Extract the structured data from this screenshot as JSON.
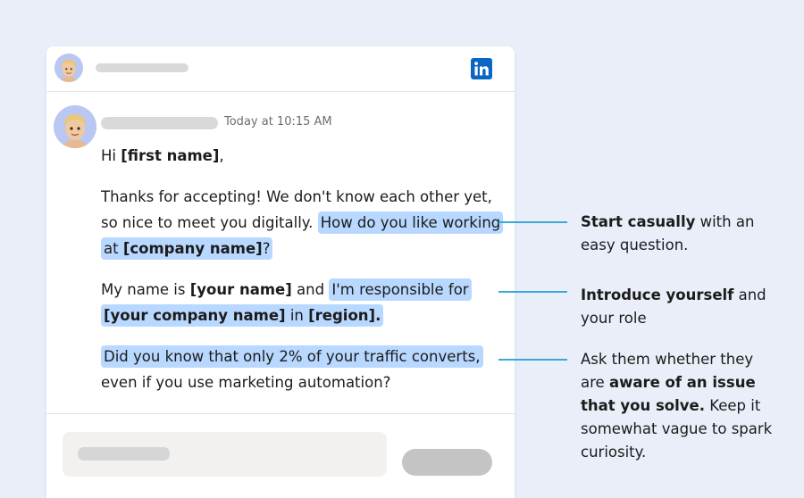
{
  "colors": {
    "background": "#e9eef8",
    "highlight": "#b9d8ff",
    "connector": "#3aa9d8",
    "linkedin": "#0a66c2",
    "avatar_bg": "#b9c7f2"
  },
  "header": {
    "brand_icon": "linkedin-icon",
    "avatar_icon": "memoji-avatar-icon"
  },
  "message": {
    "avatar_icon": "memoji-avatar-icon",
    "time": "Today at 10:15 AM",
    "greeting": {
      "prefix": "Hi ",
      "first_name": "[first name]",
      "suffix": ","
    },
    "para1": {
      "text": "Thanks for accepting! We don't know each other yet, so nice to meet you digitally. ",
      "hl_text": "How do you like working at ",
      "company": "[company name]",
      "hl_end": "?"
    },
    "para2": {
      "text": "My name is ",
      "your_name": "[your name]",
      "and": " and ",
      "hl_text": "I'm responsible for ",
      "your_company": "[your company name]",
      "in": " in ",
      "region": "[region]."
    },
    "para3": {
      "hl_text": "Did you know that only 2% of your traffic converts,",
      "text": " even if you use marketing automation?"
    }
  },
  "annotations": [
    {
      "bold": "Start casually",
      "rest": " with an easy question."
    },
    {
      "bold": "Introduce yourself",
      "rest": " and your role"
    },
    {
      "pre": "Ask them whether they are ",
      "bold": "aware of an issue that you solve.",
      "rest": " Keep it somewhat vague to spark curiosity."
    }
  ]
}
